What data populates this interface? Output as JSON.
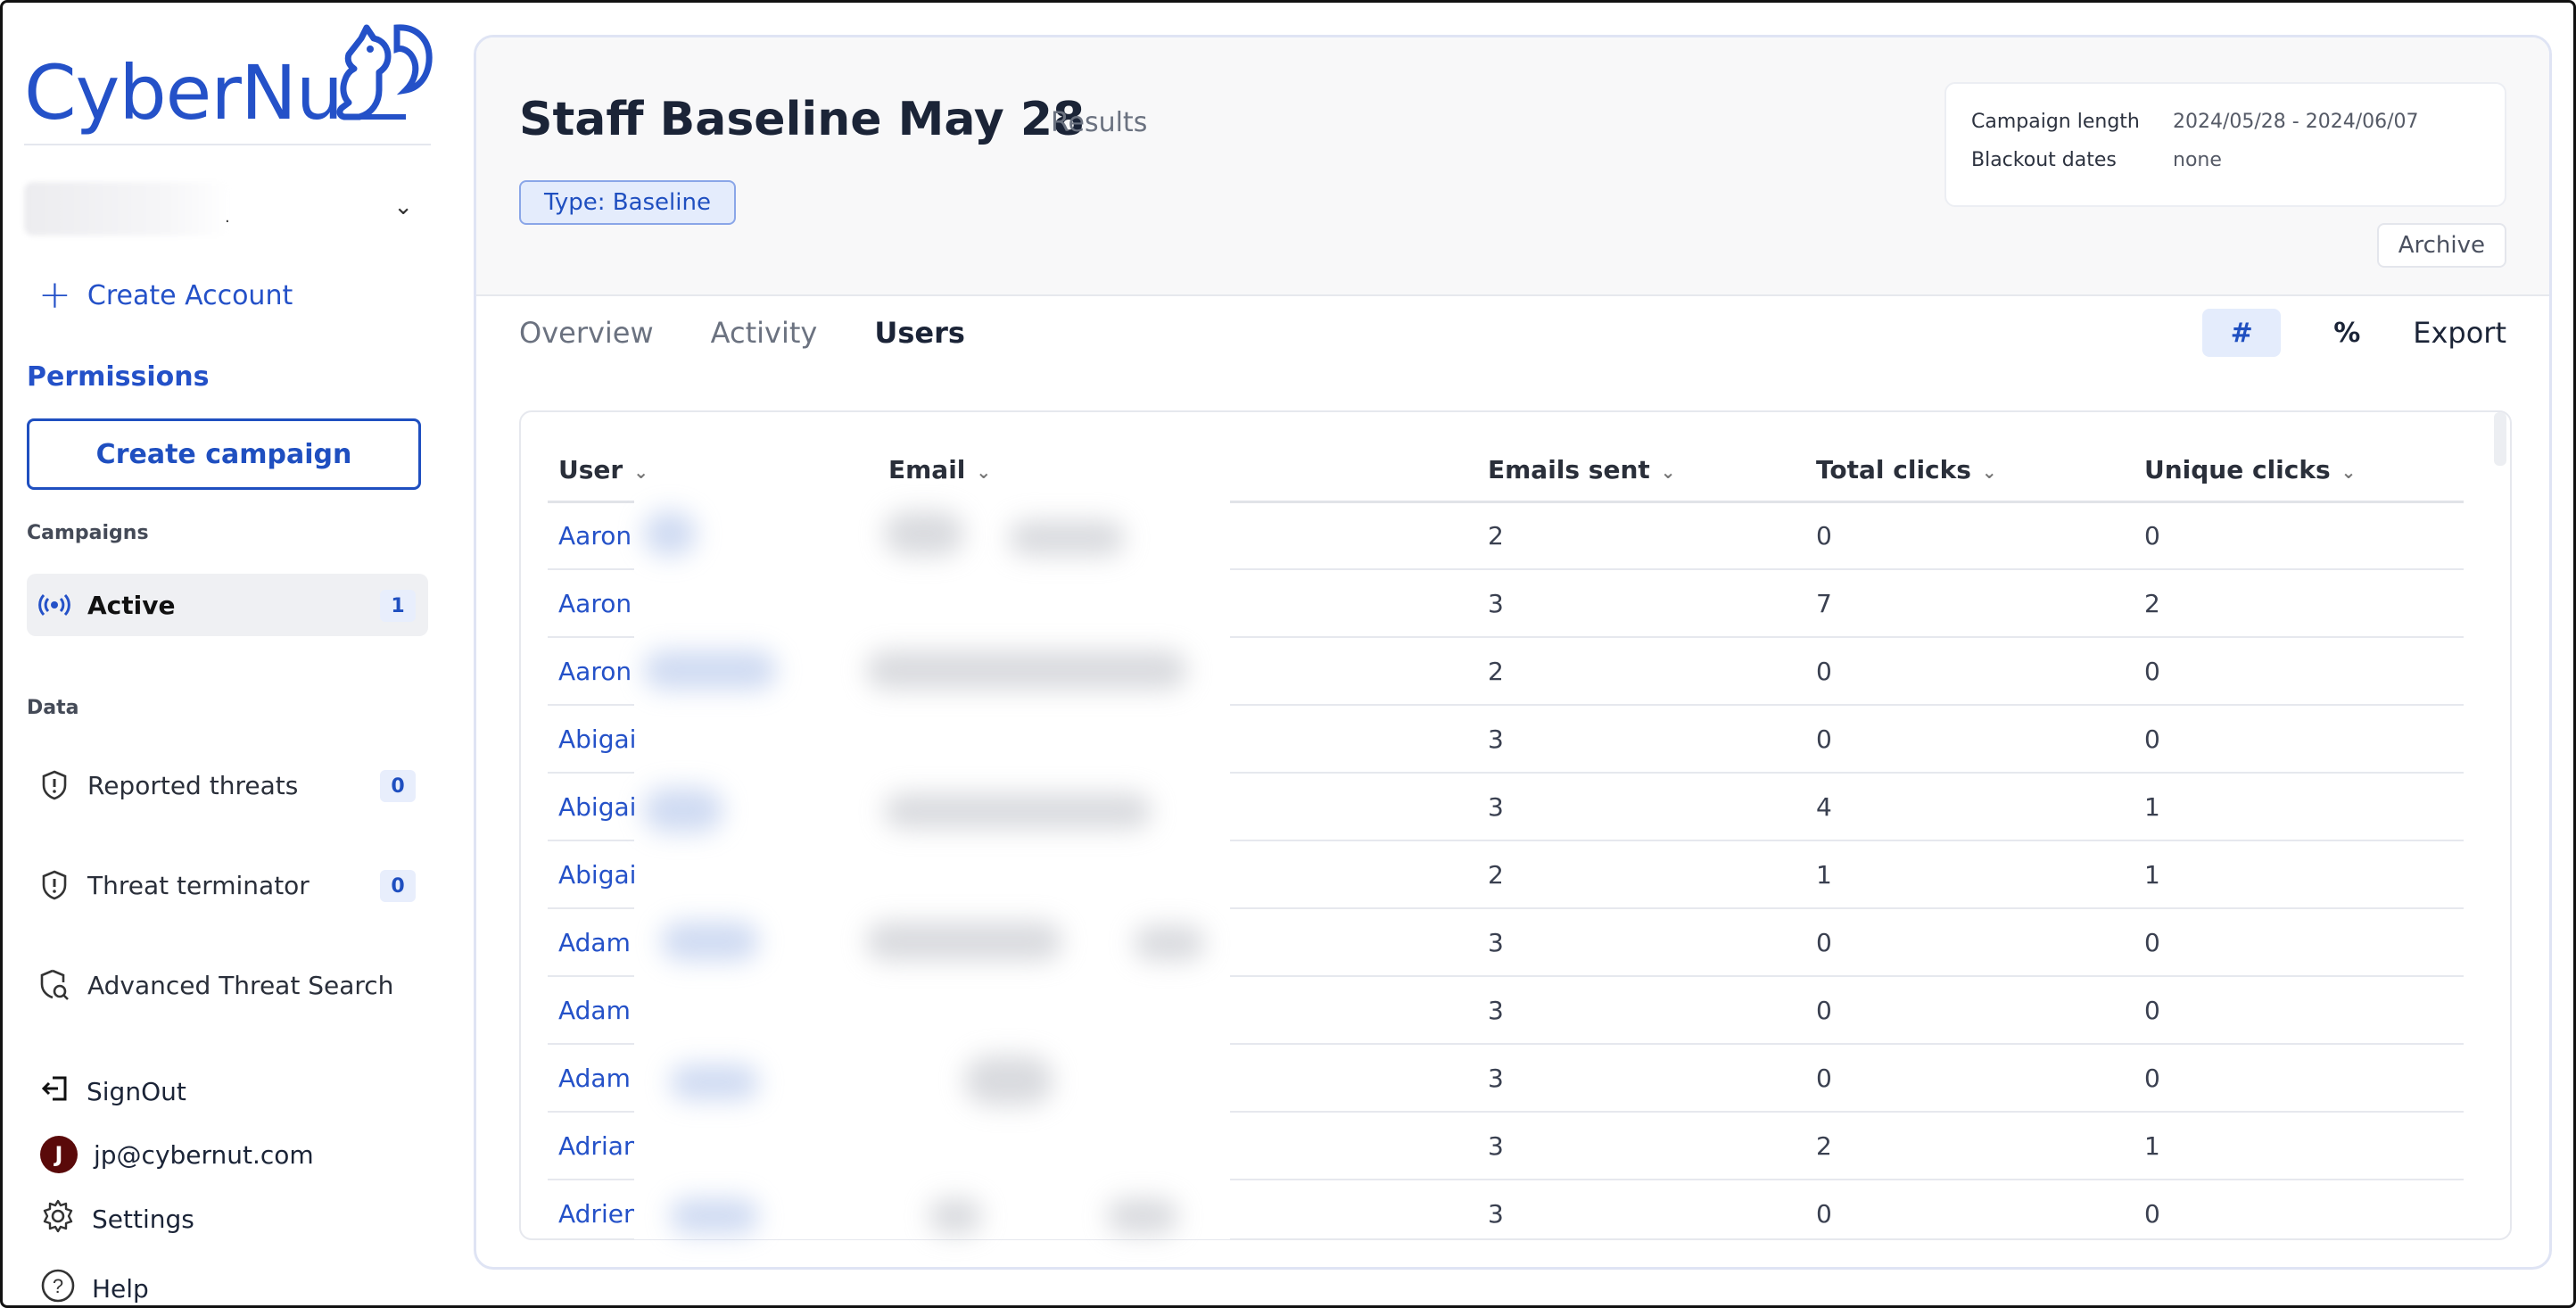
{
  "app": {
    "logo_text": "CyberNut",
    "brand_color": "#2451c8"
  },
  "sidebar": {
    "account_separator": ".",
    "create_account_label": "Create Account",
    "permissions_label": "Permissions",
    "create_campaign_label": "Create campaign",
    "campaigns_heading": "Campaigns",
    "active_item": {
      "label": "Active",
      "count": "1",
      "icon": "broadcast-icon"
    },
    "data_heading": "Data",
    "data_items": [
      {
        "label": "Reported threats",
        "count": "0",
        "icon": "shield-icon"
      },
      {
        "label": "Threat terminator",
        "count": "0",
        "icon": "shield-icon"
      },
      {
        "label": "Advanced Threat Search",
        "icon": "shield-search-icon"
      }
    ],
    "signout_label": "SignOut",
    "user_initial": "J",
    "user_email": "jp@cybernut.com",
    "settings_label": "Settings",
    "help_label": "Help"
  },
  "header": {
    "title": "Staff Baseline May 28",
    "subtitle": "Results",
    "type_badge": "Type: Baseline",
    "campaign_length_label": "Campaign length",
    "campaign_length_value": "2024/05/28 - 2024/06/07",
    "blackout_label": "Blackout dates",
    "blackout_value": "none",
    "archive_label": "Archive"
  },
  "tabs": [
    {
      "label": "Overview",
      "active": false
    },
    {
      "label": "Activity",
      "active": false
    },
    {
      "label": "Users",
      "active": true
    }
  ],
  "view_toggle": {
    "count_label": "#",
    "percent_label": "%",
    "export_label": "Export",
    "selected": "#"
  },
  "table": {
    "columns": [
      "User",
      "Email",
      "Emails sent",
      "Total clicks",
      "Unique clicks"
    ],
    "rows": [
      {
        "user": "Aaron I",
        "sent": "2",
        "total": "0",
        "unique": "0"
      },
      {
        "user": "Aaron (",
        "sent": "3",
        "total": "7",
        "unique": "2"
      },
      {
        "user": "Aaron I",
        "sent": "2",
        "total": "0",
        "unique": "0"
      },
      {
        "user": "Abigail",
        "sent": "3",
        "total": "0",
        "unique": "0"
      },
      {
        "user": "Abigail",
        "sent": "3",
        "total": "4",
        "unique": "1"
      },
      {
        "user": "Abigail",
        "sent": "2",
        "total": "1",
        "unique": "1"
      },
      {
        "user": "Adam D",
        "sent": "3",
        "total": "0",
        "unique": "0"
      },
      {
        "user": "Adam K",
        "sent": "3",
        "total": "0",
        "unique": "0"
      },
      {
        "user": "Adam Z",
        "sent": "3",
        "total": "0",
        "unique": "0"
      },
      {
        "user": "Adrianr",
        "sent": "3",
        "total": "2",
        "unique": "1"
      },
      {
        "user": "Adrienr",
        "sent": "3",
        "total": "0",
        "unique": "0"
      }
    ]
  }
}
